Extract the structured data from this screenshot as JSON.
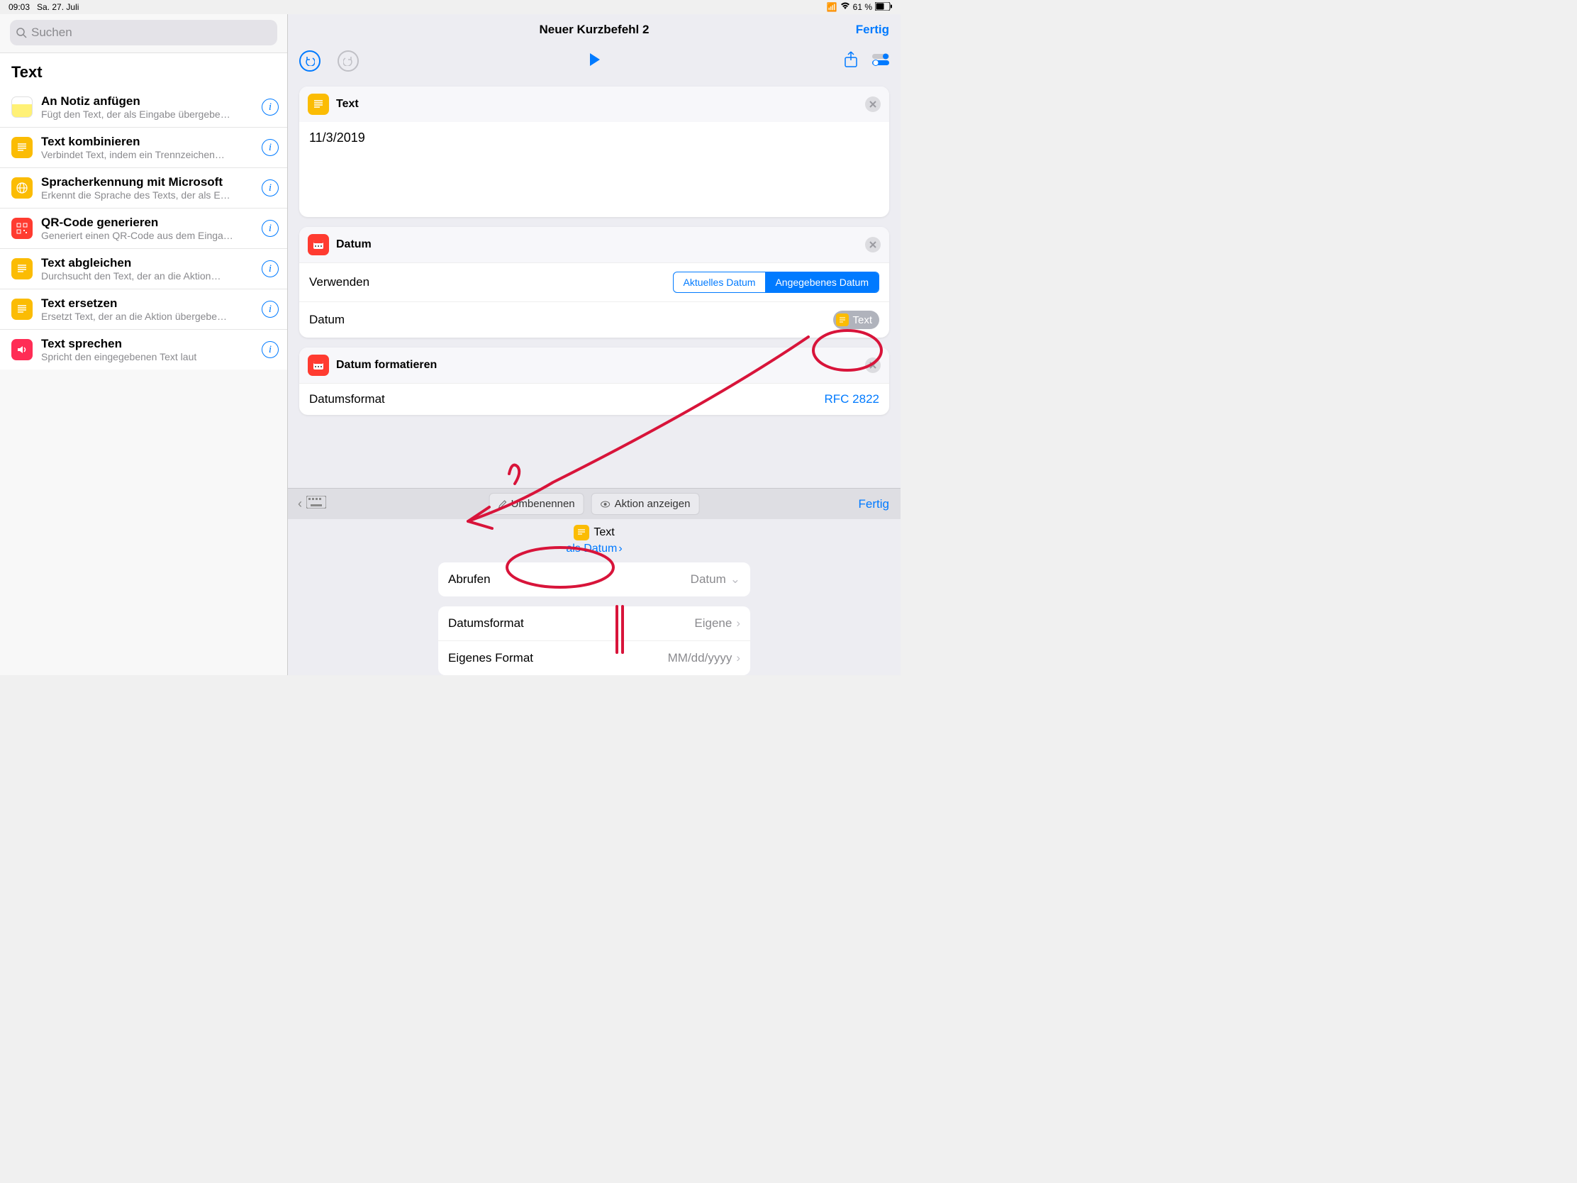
{
  "statusbar": {
    "time": "09:03",
    "date": "Sa. 27. Juli",
    "battery": "61 %"
  },
  "search": {
    "placeholder": "Suchen"
  },
  "sidebar": {
    "title": "Text",
    "items": [
      {
        "title": "An Notiz anfügen",
        "sub": "Fügt den Text, der als Eingabe übergebe…",
        "icon": "notes",
        "bg": "bg-notes"
      },
      {
        "title": "Text kombinieren",
        "sub": "Verbindet Text, indem ein Trennzeichen…",
        "icon": "text",
        "bg": "bg-yellow"
      },
      {
        "title": "Spracherkennung mit Microsoft",
        "sub": "Erkennt die Sprache des Texts, der als E…",
        "icon": "globe",
        "bg": "bg-yellow"
      },
      {
        "title": "QR-Code generieren",
        "sub": "Generiert einen QR-Code aus dem Einga…",
        "icon": "qr",
        "bg": "bg-red"
      },
      {
        "title": "Text abgleichen",
        "sub": "Durchsucht den Text, der an die Aktion…",
        "icon": "text",
        "bg": "bg-yellow"
      },
      {
        "title": "Text ersetzen",
        "sub": "Ersetzt Text, der an die Aktion übergebe…",
        "icon": "text",
        "bg": "bg-yellow"
      },
      {
        "title": "Text sprechen",
        "sub": "Spricht den eingegebenen Text laut",
        "icon": "speak",
        "bg": "bg-red2"
      }
    ]
  },
  "header": {
    "title": "Neuer Kurzbefehl 2",
    "done": "Fertig"
  },
  "kb": {
    "rename": "Umbenennen",
    "showAction": "Aktion anzeigen",
    "done": "Fertig"
  },
  "cards": {
    "text": {
      "title": "Text",
      "value": "11/3/2019"
    },
    "date": {
      "title": "Datum",
      "useLabel": "Verwenden",
      "segCurrent": "Aktuelles Datum",
      "segGiven": "Angegebenes Datum",
      "dateLabel": "Datum",
      "pill": "Text"
    },
    "format": {
      "title": "Datum formatieren",
      "rowLabel": "Datumsformat",
      "rowValue": "RFC 2822"
    }
  },
  "variable": {
    "name": "Text",
    "as": "als Datum"
  },
  "settings": {
    "rows": [
      {
        "label": "Abrufen",
        "value": "Datum",
        "chev": "down"
      },
      {
        "label": "Datumsformat",
        "value": "Eigene",
        "chev": "right"
      },
      {
        "label": "Eigenes Format",
        "value": "MM/dd/yyyy",
        "chev": "right"
      }
    ]
  }
}
